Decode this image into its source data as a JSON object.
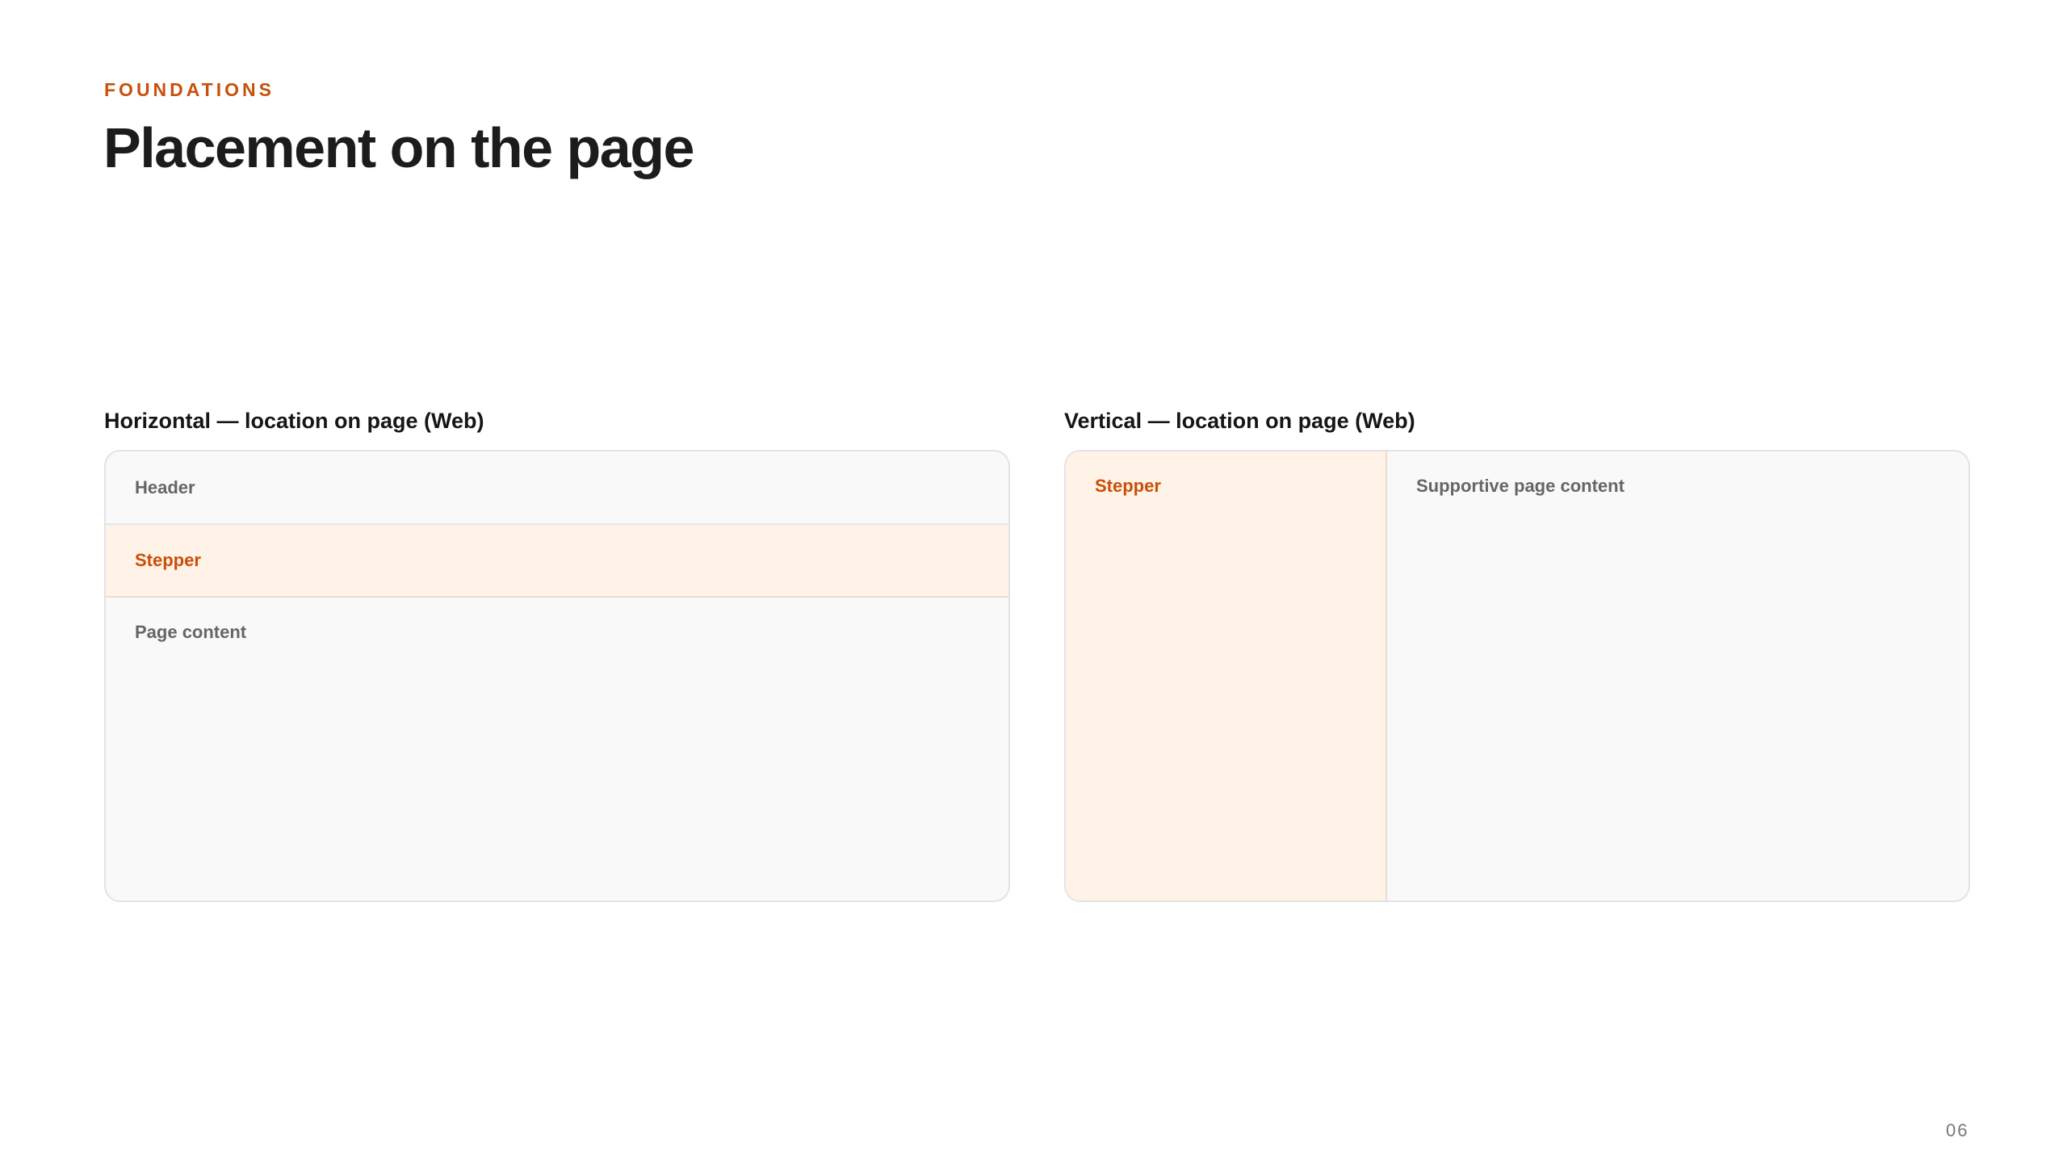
{
  "eyebrow": "FOUNDATIONS",
  "title": "Placement on the page",
  "panels": {
    "horizontal": {
      "heading": "Horizontal — location on page (Web)",
      "header_label": "Header",
      "stepper_label": "Stepper",
      "content_label": "Page content"
    },
    "vertical": {
      "heading": "Vertical — location on page (Web)",
      "stepper_label": "Stepper",
      "content_label": "Supportive page content"
    }
  },
  "page_number": "06",
  "colors": {
    "accent": "#c8500a",
    "stepper_fill": "#fff2e7",
    "frame_fill": "#f9f9f9",
    "frame_border": "#e3e3e3",
    "muted_text": "#666666"
  }
}
